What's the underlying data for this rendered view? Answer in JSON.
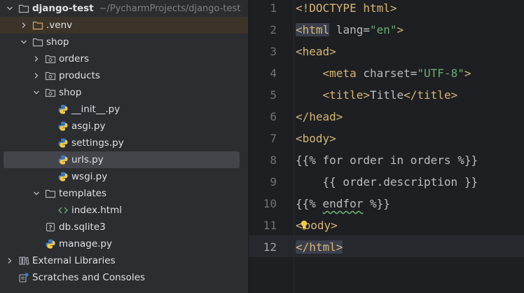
{
  "project_tree": {
    "root": {
      "label": "django-test",
      "path_hint": "~/PycharmProjects/django-test"
    },
    "items": [
      {
        "label": ".venv"
      },
      {
        "label": "shop"
      },
      {
        "label": "orders"
      },
      {
        "label": "products"
      },
      {
        "label": "shop"
      },
      {
        "label": "__init__.py"
      },
      {
        "label": "asgi.py"
      },
      {
        "label": "settings.py"
      },
      {
        "label": "urls.py"
      },
      {
        "label": "wsgi.py"
      },
      {
        "label": "templates"
      },
      {
        "label": "index.html"
      },
      {
        "label": "db.sqlite3"
      },
      {
        "label": "manage.py"
      },
      {
        "label": "External Libraries"
      },
      {
        "label": "Scratches and Consoles"
      }
    ]
  },
  "editor": {
    "line_numbers": [
      "1",
      "2",
      "3",
      "4",
      "5",
      "6",
      "7",
      "8",
      "9",
      "10",
      "11",
      "12"
    ],
    "current_line": "12",
    "lines": [
      {
        "p0": "<!DOCTYPE html>"
      },
      {
        "p0": "<html",
        "p1": " lang",
        "p2": "=",
        "p3": "\"en\"",
        "p4": ">"
      },
      {
        "p0": "<head>"
      },
      {
        "p0": "    ",
        "p1": "<meta",
        "p2": " charset",
        "p3": "=",
        "p4": "\"UTF-8\"",
        "p5": ">"
      },
      {
        "p0": "    ",
        "p1": "<title>",
        "p2": "Title",
        "p3": "</title>"
      },
      {
        "p0": "</head>"
      },
      {
        "p0": "<body>"
      },
      {
        "p0": "{{% for order in orders %}}"
      },
      {
        "p0": "    {{ order.description }}"
      },
      {
        "p0": "{{% ",
        "p1": "endfor",
        "p2": " %}}"
      },
      {
        "p0": "<",
        "p1": "body>"
      },
      {
        "p0": "</html>"
      }
    ]
  },
  "colors": {
    "tree_bg": "#2b2d30",
    "editor_bg": "#1e1f22",
    "tag": "#d5b778",
    "string": "#6aab73",
    "excluded_folder": "#d4a373",
    "selection": "#43454a"
  },
  "icons": {
    "folder": "folder-icon",
    "package": "package-folder-icon",
    "python_file": "python-file-icon",
    "html_file": "html-file-icon",
    "database": "database-file-icon",
    "libraries": "libraries-icon",
    "scratches": "scratches-icon",
    "intention_bulb": "lightbulb-icon"
  }
}
